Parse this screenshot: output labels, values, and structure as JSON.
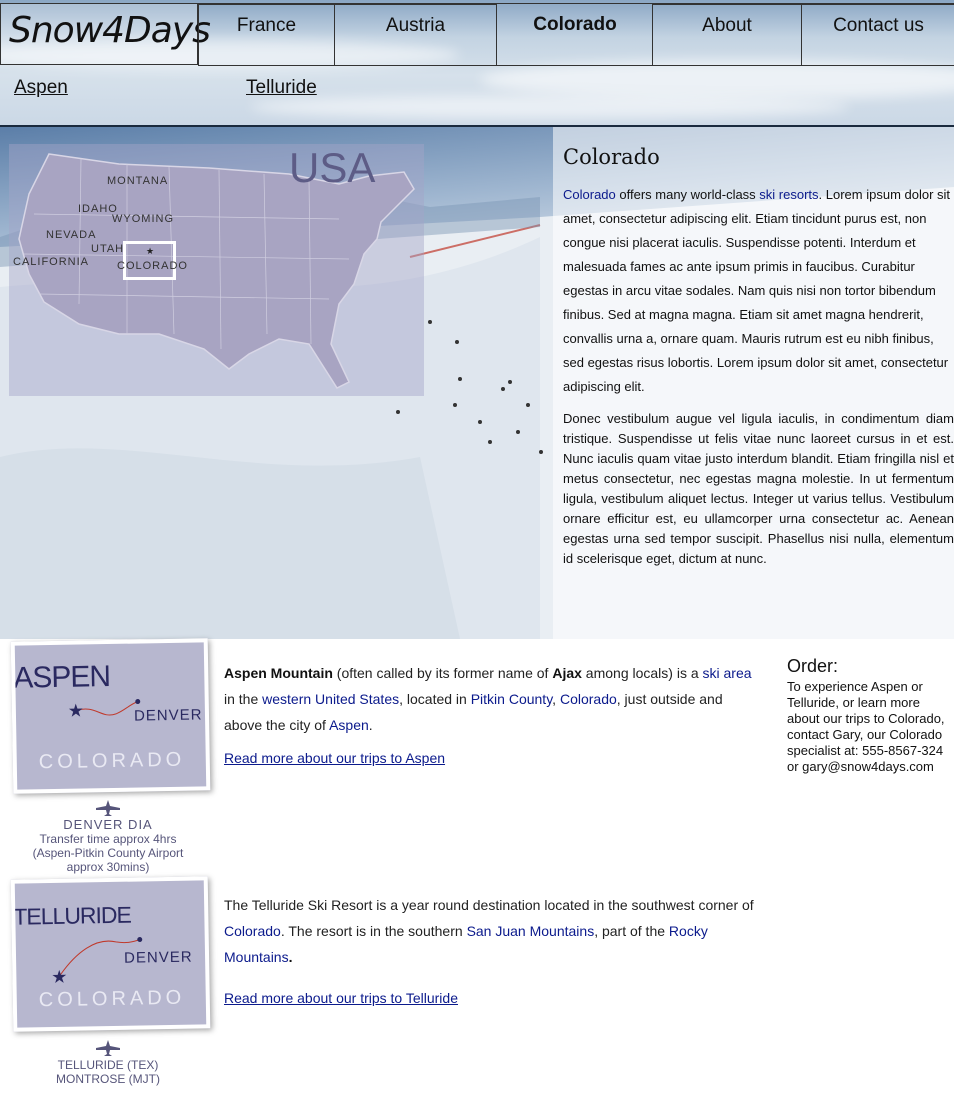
{
  "logo": {
    "text": "Snow4Days"
  },
  "nav": [
    {
      "label": "France"
    },
    {
      "label": "Austria"
    },
    {
      "label": "Colorado",
      "active": true
    },
    {
      "label": "About"
    },
    {
      "label": "Contact us"
    }
  ],
  "subnav": [
    {
      "label": "Aspen"
    },
    {
      "label": "Telluride"
    }
  ],
  "map": {
    "title": "USA",
    "states": [
      "MONTANA",
      "IDAHO",
      "WYOMING",
      "NEVADA",
      "UTAH",
      "CALIFORNIA",
      "COLORADO"
    ]
  },
  "intro": {
    "heading": "Colorado",
    "p1_link1": "Colorado",
    "p1_mid": " offers many world-class ",
    "p1_link2": "ski resorts",
    "p1_rest": ". Lorem ipsum dolor sit amet, consectetur adipiscing elit. Etiam tincidunt purus est, non congue nisi placerat iaculis. Suspendisse potenti. Interdum et malesuada fames ac ante ipsum primis in faucibus. Curabitur egestas in arcu vitae sodales. Nam quis nisi non tortor bibendum finibus. Sed at magna magna. Etiam sit amet magna hendrerit, convallis urna a, ornare quam. Mauris rutrum est eu nibh finibus, sed egestas risus lobortis. Lorem ipsum dolor sit amet, consectetur adipiscing elit.",
    "p2": "Donec vestibulum augue vel ligula iaculis, in condimentum diam tristique. Suspendisse ut felis vitae nunc laoreet cursus in et est. Nunc iaculis quam vitae justo interdum blandit. Etiam fringilla nisl et metus consectetur, nec egestas magna molestie. In ut fermentum ligula, vestibulum aliquet lectus. Integer ut varius tellus. Vestibulum ornare efficitur est, eu ullamcorper urna consectetur ac. Aenean egestas urna sed tempor suscipit. Phasellus nisi nulla, elementum id scelerisque eget, dictum at nunc."
  },
  "aspen": {
    "card_name": "ASPEN",
    "card_denver": "DENVER",
    "card_state": "COLORADO",
    "airport_name": "DENVER DIA",
    "airport_l1": "Transfer time approx 4hrs",
    "airport_l2": "(Aspen-Pitkin County Airport",
    "airport_l3": "approx 30mins)",
    "t_bold1": "Aspen Mountain",
    "t1": " (often called by its former name of ",
    "t_bold2": "Ajax",
    "t2": " among locals) is a ",
    "l_skiarea": "ski area",
    "t3": " in the ",
    "l_western": "western United States",
    "t4": ", located in ",
    "l_pitkin": "Pitkin County",
    "t5": ", ",
    "l_colorado": "Colorado",
    "t6": ", just outside and above the city of ",
    "l_aspen": "Aspen",
    "t7": ".",
    "readmore": "Read more about our trips to Aspen"
  },
  "telluride": {
    "card_name": "TELLURIDE",
    "card_denver": "DENVER",
    "card_state": "COLORADO",
    "airport_l1": "TELLURIDE (TEX)",
    "airport_l2": "MONTROSE (MJT)",
    "t1": "The Telluride Ski Resort is a year round destination located in the southwest corner of ",
    "l_colorado": "Colorado",
    "t2": ". The resort is in the southern ",
    "l_sanjuan": "San Juan Mountains",
    "t3": ", part of the ",
    "l_rocky": "Rocky Mountains",
    "t4": ".",
    "readmore": "Read more about our trips to Telluride"
  },
  "order": {
    "heading": "Order:",
    "text": "To experience Aspen or Telluride, or learn more about our trips to Colorado, contact Gary, our Colorado specialist at: 555-8567-324 or gary@snow4days.com"
  }
}
